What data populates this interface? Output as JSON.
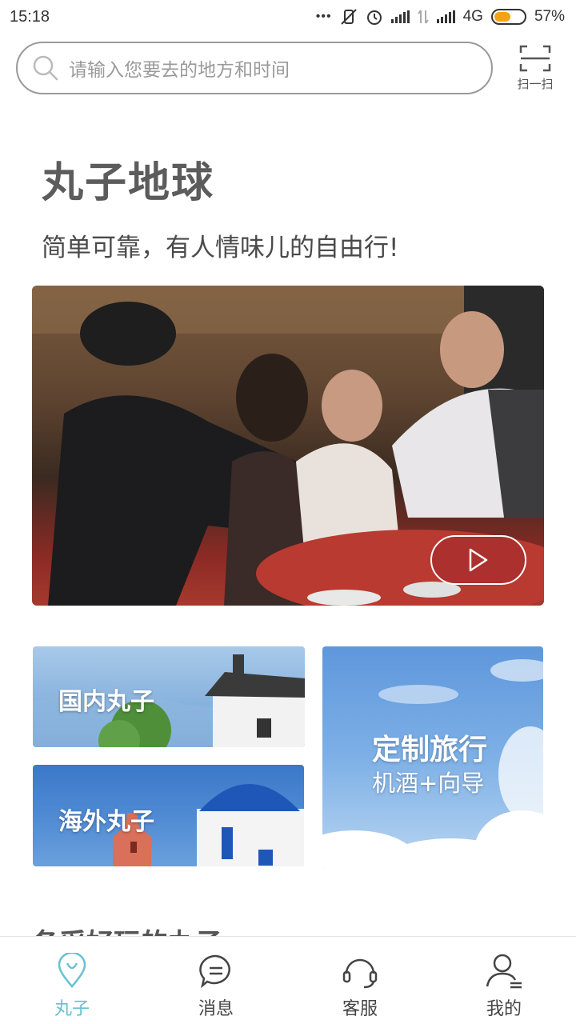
{
  "status_bar": {
    "time": "15:18",
    "network": "4G",
    "battery": "57%",
    "battery_level": 0.57
  },
  "search": {
    "placeholder": "请输入您要去的地方和时间",
    "scan_label": "扫一扫"
  },
  "brand": {
    "title": "丸子地球",
    "subtitle": "简单可靠，有人情味儿的自由行!"
  },
  "categories": {
    "domestic": "国内丸子",
    "overseas": "海外丸子",
    "custom_title": "定制旅行",
    "custom_sub": "机酒+向导"
  },
  "section_peek": "各采好玩的丸子",
  "tabbar": {
    "items": [
      {
        "label": "丸子",
        "icon": "location-pin-icon",
        "active": true
      },
      {
        "label": "消息",
        "icon": "message-icon",
        "active": false
      },
      {
        "label": "客服",
        "icon": "headset-icon",
        "active": false
      },
      {
        "label": "我的",
        "icon": "user-icon",
        "active": false
      }
    ]
  },
  "colors": {
    "accent": "#67c1cf",
    "battery": "#f5a214"
  }
}
